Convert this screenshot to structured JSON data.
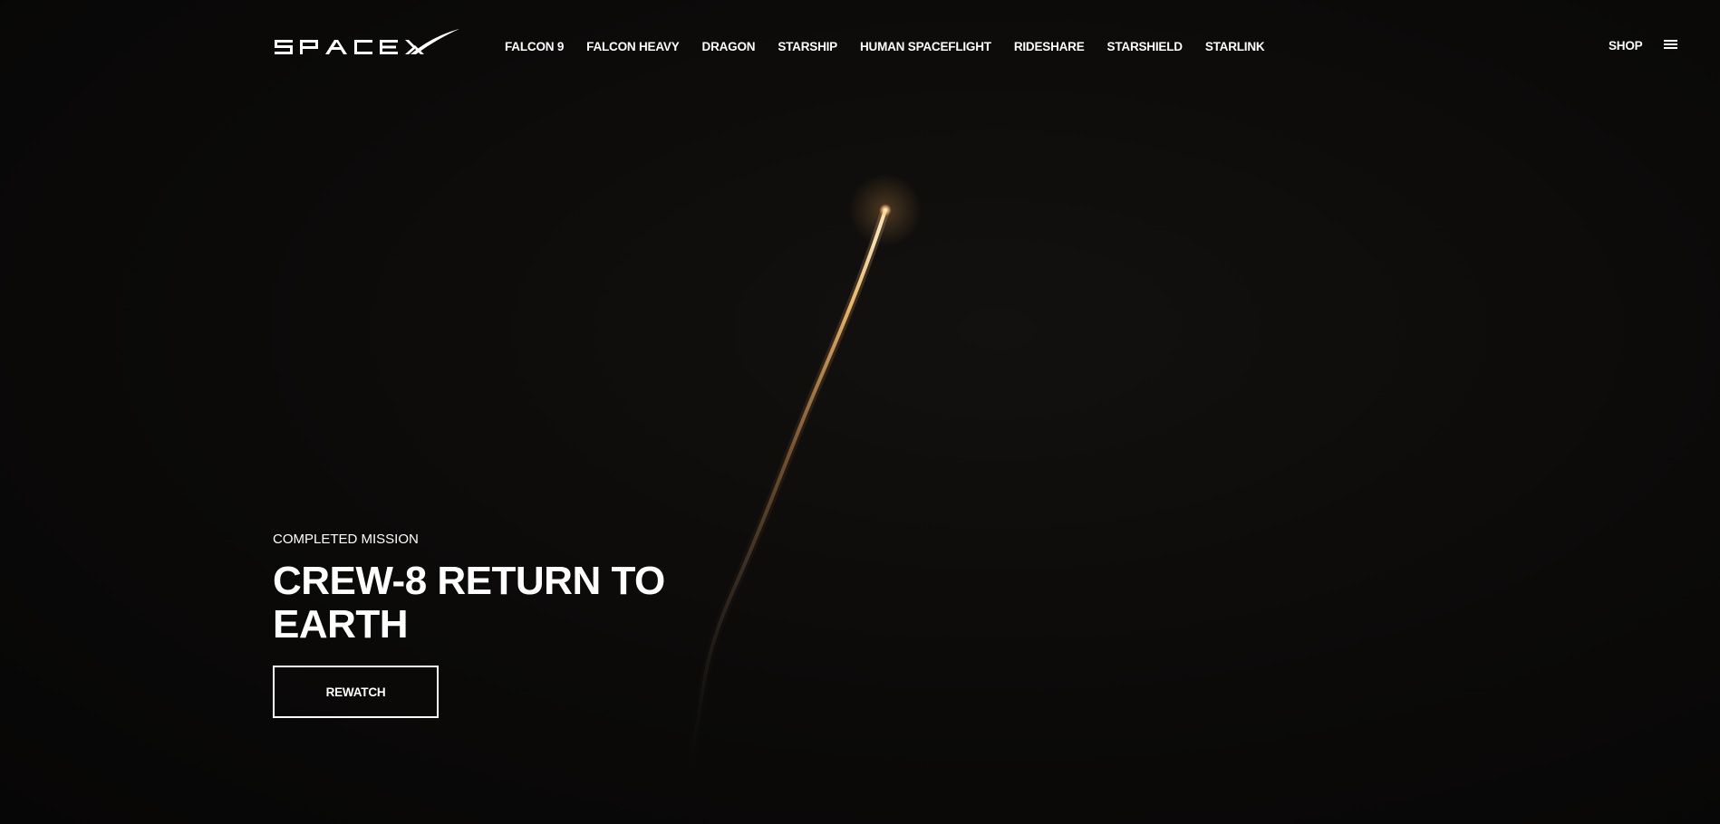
{
  "brand": {
    "logo_alt": "SpaceX logo"
  },
  "nav": {
    "items": [
      {
        "label": "FALCON 9"
      },
      {
        "label": "FALCON HEAVY"
      },
      {
        "label": "DRAGON"
      },
      {
        "label": "STARSHIP"
      },
      {
        "label": "HUMAN SPACEFLIGHT"
      },
      {
        "label": "RIDESHARE"
      },
      {
        "label": "STARSHIELD"
      },
      {
        "label": "STARLINK"
      }
    ],
    "shop_label": "SHOP",
    "menu_icon": "hamburger-menu-icon"
  },
  "hero": {
    "eyebrow": "COMPLETED MISSION",
    "headline_line1": "CREW-8 RETURN TO",
    "headline_line2": "EARTH",
    "cta_label": "REWATCH"
  },
  "colors": {
    "background": "#0a0908",
    "text": "#ffffff",
    "rocket_glow": "#ffd58a",
    "trail": "#c88a4a"
  }
}
